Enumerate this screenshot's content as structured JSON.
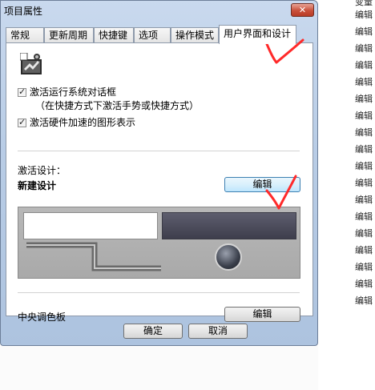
{
  "window": {
    "title": "项目属性",
    "close_label": "✕"
  },
  "tabs": [
    {
      "label": "常规"
    },
    {
      "label": "更新周期"
    },
    {
      "label": "快捷键"
    },
    {
      "label": "选项"
    },
    {
      "label": "操作模式"
    },
    {
      "label": "用户界面和设计",
      "active": true
    }
  ],
  "options": {
    "activate_run_dialog": {
      "label": "激活运行系统对话框",
      "sublabel": "（在快捷方式下激活手势或快捷方式）",
      "checked": true
    },
    "hardware_accel": {
      "label": "激活硬件加速的图形表示",
      "checked": true
    }
  },
  "design": {
    "section_label": "激活设计：",
    "design_name": "新建设计",
    "edit_label": "编辑"
  },
  "palette": {
    "label": "中央调色板",
    "edit_label": "编辑"
  },
  "footer": {
    "ok_label": "确定",
    "cancel_label": "取消"
  },
  "background_list": {
    "top_partial": "变量",
    "items": [
      "编辑",
      "编辑",
      "编辑",
      "编辑",
      "编辑",
      "编辑",
      "编辑",
      "编辑",
      "编辑",
      "编辑",
      "编辑",
      "编辑",
      "编辑",
      "编辑",
      "编辑",
      "编辑",
      "编辑",
      "编辑"
    ]
  },
  "colors": {
    "annotation": "#ff2a2a",
    "focused_button": "#bee6fd"
  }
}
